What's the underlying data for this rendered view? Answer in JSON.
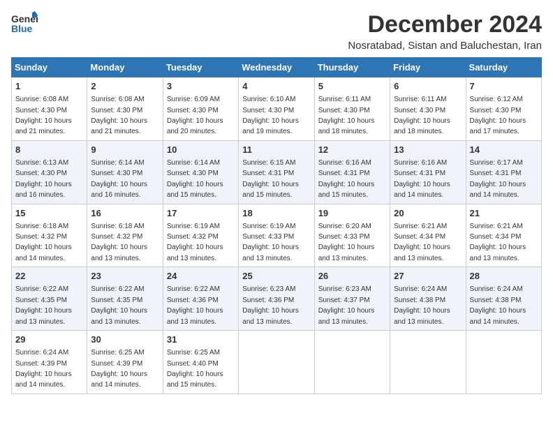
{
  "logo": {
    "general": "General",
    "blue": "Blue"
  },
  "title": "December 2024",
  "location": "Nosratabad, Sistan and Baluchestan, Iran",
  "days_of_week": [
    "Sunday",
    "Monday",
    "Tuesday",
    "Wednesday",
    "Thursday",
    "Friday",
    "Saturday"
  ],
  "weeks": [
    [
      {
        "day": "1",
        "sunrise": "6:08 AM",
        "sunset": "4:30 PM",
        "daylight": "10 hours and 21 minutes."
      },
      {
        "day": "2",
        "sunrise": "6:08 AM",
        "sunset": "4:30 PM",
        "daylight": "10 hours and 21 minutes."
      },
      {
        "day": "3",
        "sunrise": "6:09 AM",
        "sunset": "4:30 PM",
        "daylight": "10 hours and 20 minutes."
      },
      {
        "day": "4",
        "sunrise": "6:10 AM",
        "sunset": "4:30 PM",
        "daylight": "10 hours and 19 minutes."
      },
      {
        "day": "5",
        "sunrise": "6:11 AM",
        "sunset": "4:30 PM",
        "daylight": "10 hours and 18 minutes."
      },
      {
        "day": "6",
        "sunrise": "6:11 AM",
        "sunset": "4:30 PM",
        "daylight": "10 hours and 18 minutes."
      },
      {
        "day": "7",
        "sunrise": "6:12 AM",
        "sunset": "4:30 PM",
        "daylight": "10 hours and 17 minutes."
      }
    ],
    [
      {
        "day": "8",
        "sunrise": "6:13 AM",
        "sunset": "4:30 PM",
        "daylight": "10 hours and 16 minutes."
      },
      {
        "day": "9",
        "sunrise": "6:14 AM",
        "sunset": "4:30 PM",
        "daylight": "10 hours and 16 minutes."
      },
      {
        "day": "10",
        "sunrise": "6:14 AM",
        "sunset": "4:30 PM",
        "daylight": "10 hours and 15 minutes."
      },
      {
        "day": "11",
        "sunrise": "6:15 AM",
        "sunset": "4:31 PM",
        "daylight": "10 hours and 15 minutes."
      },
      {
        "day": "12",
        "sunrise": "6:16 AM",
        "sunset": "4:31 PM",
        "daylight": "10 hours and 15 minutes."
      },
      {
        "day": "13",
        "sunrise": "6:16 AM",
        "sunset": "4:31 PM",
        "daylight": "10 hours and 14 minutes."
      },
      {
        "day": "14",
        "sunrise": "6:17 AM",
        "sunset": "4:31 PM",
        "daylight": "10 hours and 14 minutes."
      }
    ],
    [
      {
        "day": "15",
        "sunrise": "6:18 AM",
        "sunset": "4:32 PM",
        "daylight": "10 hours and 14 minutes."
      },
      {
        "day": "16",
        "sunrise": "6:18 AM",
        "sunset": "4:32 PM",
        "daylight": "10 hours and 13 minutes."
      },
      {
        "day": "17",
        "sunrise": "6:19 AM",
        "sunset": "4:32 PM",
        "daylight": "10 hours and 13 minutes."
      },
      {
        "day": "18",
        "sunrise": "6:19 AM",
        "sunset": "4:33 PM",
        "daylight": "10 hours and 13 minutes."
      },
      {
        "day": "19",
        "sunrise": "6:20 AM",
        "sunset": "4:33 PM",
        "daylight": "10 hours and 13 minutes."
      },
      {
        "day": "20",
        "sunrise": "6:21 AM",
        "sunset": "4:34 PM",
        "daylight": "10 hours and 13 minutes."
      },
      {
        "day": "21",
        "sunrise": "6:21 AM",
        "sunset": "4:34 PM",
        "daylight": "10 hours and 13 minutes."
      }
    ],
    [
      {
        "day": "22",
        "sunrise": "6:22 AM",
        "sunset": "4:35 PM",
        "daylight": "10 hours and 13 minutes."
      },
      {
        "day": "23",
        "sunrise": "6:22 AM",
        "sunset": "4:35 PM",
        "daylight": "10 hours and 13 minutes."
      },
      {
        "day": "24",
        "sunrise": "6:22 AM",
        "sunset": "4:36 PM",
        "daylight": "10 hours and 13 minutes."
      },
      {
        "day": "25",
        "sunrise": "6:23 AM",
        "sunset": "4:36 PM",
        "daylight": "10 hours and 13 minutes."
      },
      {
        "day": "26",
        "sunrise": "6:23 AM",
        "sunset": "4:37 PM",
        "daylight": "10 hours and 13 minutes."
      },
      {
        "day": "27",
        "sunrise": "6:24 AM",
        "sunset": "4:38 PM",
        "daylight": "10 hours and 13 minutes."
      },
      {
        "day": "28",
        "sunrise": "6:24 AM",
        "sunset": "4:38 PM",
        "daylight": "10 hours and 14 minutes."
      }
    ],
    [
      {
        "day": "29",
        "sunrise": "6:24 AM",
        "sunset": "4:39 PM",
        "daylight": "10 hours and 14 minutes."
      },
      {
        "day": "30",
        "sunrise": "6:25 AM",
        "sunset": "4:39 PM",
        "daylight": "10 hours and 14 minutes."
      },
      {
        "day": "31",
        "sunrise": "6:25 AM",
        "sunset": "4:40 PM",
        "daylight": "10 hours and 15 minutes."
      },
      null,
      null,
      null,
      null
    ]
  ]
}
